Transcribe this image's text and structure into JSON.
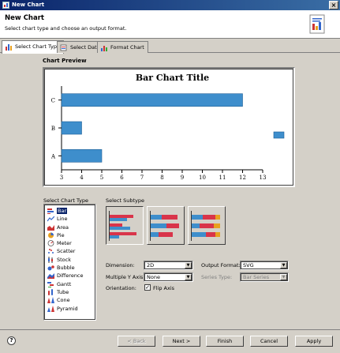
{
  "window": {
    "title": "New Chart",
    "close_glyph": "×"
  },
  "header": {
    "title": "New Chart",
    "subtitle": "Select chart type and choose an output format."
  },
  "tabs": [
    {
      "label": "Select Chart Type",
      "selected": true
    },
    {
      "label": "Select Data",
      "selected": false
    },
    {
      "label": "Format Chart",
      "selected": false
    }
  ],
  "preview": {
    "label": "Chart Preview"
  },
  "chart_data": {
    "type": "bar",
    "orientation": "horizontal",
    "title": "Bar Chart Title",
    "categories": [
      "A",
      "B",
      "C"
    ],
    "series": [
      {
        "values": [
          5,
          4,
          12
        ],
        "color": "#3e8ecc"
      }
    ],
    "xlim": [
      3,
      13
    ],
    "xticks": [
      "3",
      "4",
      "5",
      "6",
      "7",
      "8",
      "9",
      "10",
      "11",
      "12",
      "13"
    ],
    "legend": "right",
    "grid": false
  },
  "chart_type": {
    "label": "Select Chart Type",
    "items": [
      {
        "label": "Bar",
        "icon": "bar-chart-icon",
        "selected": true
      },
      {
        "label": "Line",
        "icon": "line-chart-icon"
      },
      {
        "label": "Area",
        "icon": "area-chart-icon"
      },
      {
        "label": "Pie",
        "icon": "pie-chart-icon"
      },
      {
        "label": "Meter",
        "icon": "meter-chart-icon"
      },
      {
        "label": "Scatter",
        "icon": "scatter-chart-icon"
      },
      {
        "label": "Stock",
        "icon": "stock-chart-icon"
      },
      {
        "label": "Bubble",
        "icon": "bubble-chart-icon"
      },
      {
        "label": "Difference",
        "icon": "difference-chart-icon"
      },
      {
        "label": "Gantt",
        "icon": "gantt-chart-icon"
      },
      {
        "label": "Tube",
        "icon": "tube-chart-icon"
      },
      {
        "label": "Cone",
        "icon": "cone-chart-icon"
      },
      {
        "label": "Pyramid",
        "icon": "pyramid-chart-icon"
      }
    ]
  },
  "subtype": {
    "label": "Select Subtype",
    "options": [
      "side-by-side",
      "stacked",
      "percent-stacked"
    ],
    "selected_index": 0
  },
  "form": {
    "dimension_label": "Dimension:",
    "dimension_value": "2D",
    "multiple_y_label": "Multiple Y Axis:",
    "multiple_y_value": "None",
    "orientation_label": "Orientation:",
    "flip_label": "Flip Axis",
    "flip_checked": true,
    "check_glyph": "✓",
    "output_format_label": "Output Format:",
    "output_format_value": "SVG",
    "series_type_label": "Series Type:",
    "series_type_value": "Bar Series",
    "series_type_enabled": false
  },
  "footer": {
    "help_glyph": "?",
    "back": "< Back",
    "next": "Next >",
    "finish": "Finish",
    "cancel": "Cancel",
    "apply": "Apply"
  }
}
